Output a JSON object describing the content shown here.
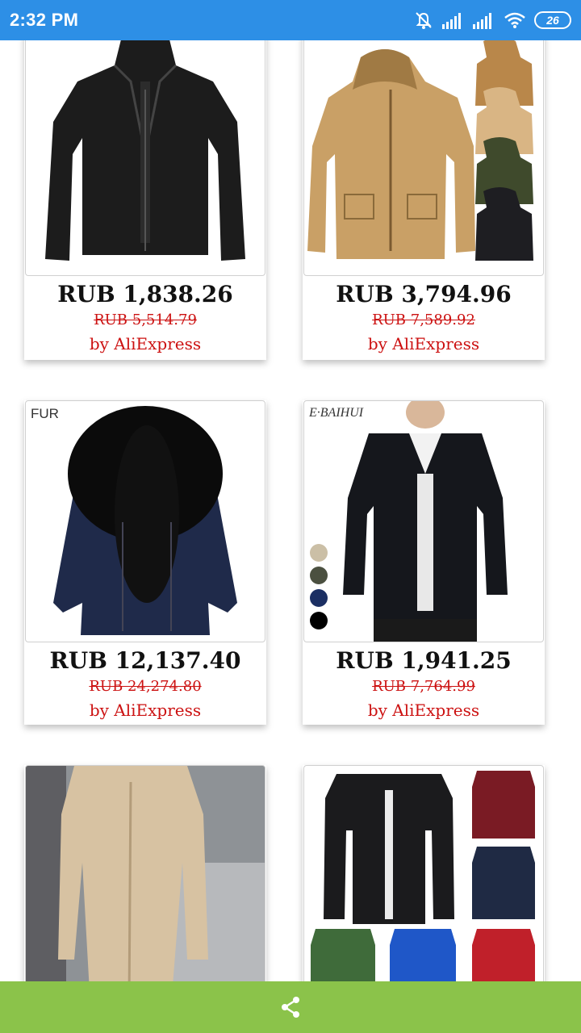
{
  "status_bar": {
    "time": "2:32 PM",
    "battery": "26"
  },
  "products": [
    {
      "price": "RUB 1,838.26",
      "old_price": "RUB 5,514.79",
      "seller": "by AliExpress",
      "image": "black-jacket-image"
    },
    {
      "price": "RUB 3,794.96",
      "old_price": "RUB 7,589.92",
      "seller": "by AliExpress",
      "image": "khaki-parka-image"
    },
    {
      "price": "RUB 12,137.40",
      "old_price": "RUB 24,274.80",
      "seller": "by AliExpress",
      "image": "fur-hood-parka-image",
      "brand": "FUR"
    },
    {
      "price": "RUB 1,941.25",
      "old_price": "RUB 7,764.99",
      "seller": "by AliExpress",
      "image": "black-jacket-model-image",
      "brand": "E·BAIHUI"
    },
    {
      "image": "beige-coat-image"
    },
    {
      "image": "quilted-bomber-image"
    }
  ],
  "bottom_bar": {
    "icon": "share-icon"
  }
}
